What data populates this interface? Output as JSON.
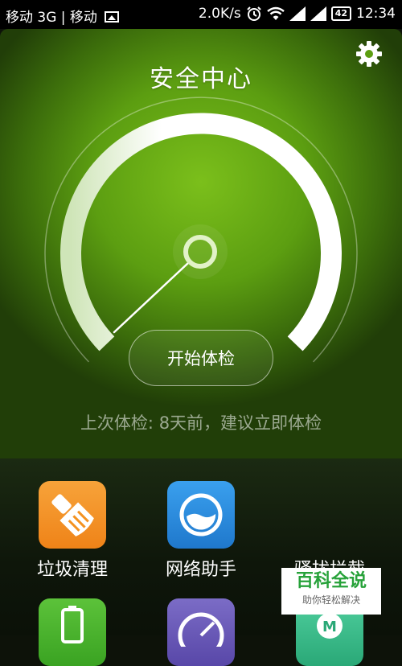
{
  "status_bar": {
    "carrier_text": "移动 3G | 移动",
    "speed": "2.0K/s",
    "battery": "42",
    "time": "12:34"
  },
  "header": {
    "title": "安全中心",
    "settings_icon": "gear-icon"
  },
  "gauge": {
    "level": 0
  },
  "actions": {
    "start_check_label": "开始体检",
    "last_check_text": "上次体检: 8天前，建议立即体检"
  },
  "tools": [
    {
      "label": "垃圾清理",
      "icon": "broom-icon",
      "color": "#f49220"
    },
    {
      "label": "网络助手",
      "icon": "network-icon",
      "color": "#2d8fe0"
    },
    {
      "label": "骚扰拦截",
      "icon": "block-icon",
      "color": "#ffffff"
    },
    {
      "label": "",
      "icon": "battery-icon",
      "color": "#49b52b"
    },
    {
      "label": "",
      "icon": "permission-icon",
      "color": "#6a5bb5"
    },
    {
      "label": "",
      "icon": "m-icon",
      "color": "#3bbf8d"
    }
  ],
  "watermark": {
    "title": "百科全说",
    "subtitle": "助你轻松解决"
  }
}
